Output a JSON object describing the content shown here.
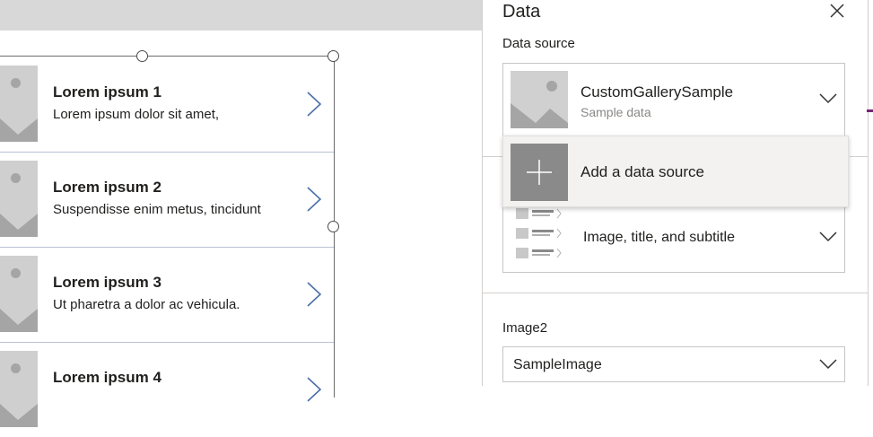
{
  "gallery": {
    "items": [
      {
        "title": "Lorem ipsum 1",
        "subtitle": "Lorem ipsum dolor sit amet,"
      },
      {
        "title": "Lorem ipsum 2",
        "subtitle": "Suspendisse enim metus, tincidunt"
      },
      {
        "title": "Lorem ipsum 3",
        "subtitle": "Ut pharetra a dolor ac vehicula."
      },
      {
        "title": "Lorem ipsum 4",
        "subtitle": ""
      }
    ]
  },
  "panel": {
    "title": "Data",
    "data_source_label": "Data source",
    "data_source": {
      "name": "CustomGallerySample",
      "subtitle": "Sample data"
    },
    "menu": {
      "add_label": "Add a data source"
    },
    "layout": {
      "value": "Image, title, and subtitle"
    },
    "image_field": {
      "label": "Image2",
      "value": "SampleImage"
    }
  },
  "colors": {
    "accent": "#742774",
    "selection_border": "#6b6b6b",
    "row_divider": "#b8c3d6"
  }
}
